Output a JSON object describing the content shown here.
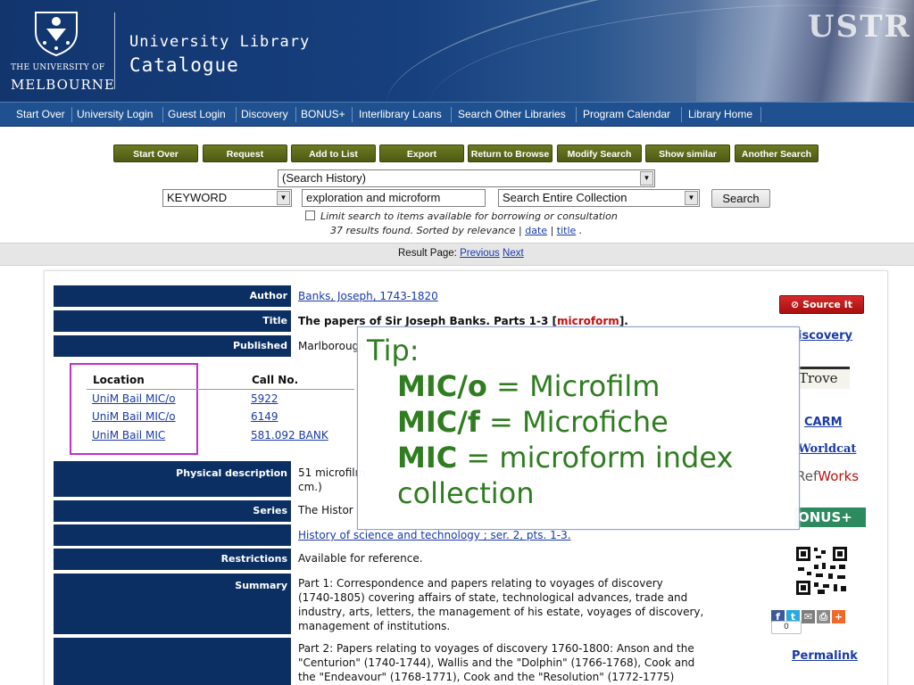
{
  "header": {
    "university_line1": "THE UNIVERSITY OF",
    "university_line2": "MELBOURNE",
    "title_line1": "University Library",
    "title_line2": "Catalogue",
    "banner_spine_text": "USTR"
  },
  "nav": {
    "items": [
      "Start Over",
      "University Login",
      "Guest Login",
      "Discovery",
      "BONUS+",
      "Interlibrary Loans",
      "Search Other Libraries",
      "Program Calendar",
      "Library Home"
    ]
  },
  "toolbar": {
    "buttons": [
      "Start Over",
      "Request",
      "Add to List",
      "Export",
      "Return to Browse",
      "Modify Search",
      "Show similar Items",
      "Another Search"
    ]
  },
  "search": {
    "history_select": "(Search History)",
    "index_select": "KEYWORD",
    "query": "exploration and microform",
    "scope_select": "Search Entire Collection",
    "search_button": "Search",
    "limit_label": "Limit search to items available for borrowing or consultation",
    "results_text": "37 results found. Sorted by relevance |",
    "sort_date": "date",
    "sort_sep": "|",
    "sort_title": "title",
    "sort_end": "."
  },
  "result_page": {
    "label": "Result Page:",
    "previous": "Previous",
    "next": "Next"
  },
  "record": {
    "author_label": "Author",
    "author_value": "Banks, Joseph, 1743-1820",
    "title_label": "Title",
    "title_value": "The papers of Sir Joseph Banks. Parts 1-3 [",
    "title_micro": "microform",
    "title_end": "].",
    "published_label": "Published",
    "published_value": "Marlborough",
    "physical_label": "Physical description",
    "physical_value_1": "51 microfilm",
    "physical_value_2": "cm.)",
    "series_label": "Series",
    "series_value": "The Histor",
    "series_link": "History of science and technology ; ser. 2, pts. 1-3.",
    "restrictions_label": "Restrictions",
    "restrictions_value": "Available for reference.",
    "summary_label": "Summary",
    "summary_1": [
      "Part 1: Correspondence and papers relating to voyages of discovery",
      "(1740-1805) covering affairs of state, technological advances, trade and",
      "industry, arts, letters, the management of his estate, voyages of discovery,",
      "management of institutions."
    ],
    "summary_2": [
      "Part 2: Papers relating to voyages of discovery 1760-1800: Anson and the",
      "\"Centurion\" (1740-1744), Wallis and the \"Dolphin\" (1766-1768), Cook and",
      "the \"Endeavour\" (1768-1771), Cook and the \"Resolution\" (1772-1775)"
    ]
  },
  "holdings": {
    "headers": [
      "Location",
      "Call No."
    ],
    "rows": [
      {
        "location": "UniM Bail MIC/o",
        "call_no": "5922"
      },
      {
        "location": "UniM Bail MIC/o",
        "call_no": "6149"
      },
      {
        "location": "UniM Bail MIC",
        "call_no": "581.092 BANK"
      }
    ]
  },
  "sidebar": {
    "source_it": "Source It",
    "discovery": "iscovery",
    "trove": "Trove",
    "carm": "CARM",
    "worldcat": "Worldcat",
    "refworks_1": "Ref",
    "refworks_2": "Works",
    "bonus": "ONUS+",
    "share_count": "0",
    "permalink": "Permalink"
  },
  "tip": {
    "heading": "Tip:",
    "line1_code": "MIC/o",
    "line1_rest": " =  Microfilm",
    "line2_code": "MIC/f",
    "line2_rest": "  =  Microfiche",
    "line3_code": "MIC",
    "line3_rest": " =  microform index",
    "line4": "collection"
  },
  "colors": {
    "nav_bg": "#1f5190",
    "label_bg": "#0c2f63",
    "tip_text": "#2f7d20",
    "highlight_box": "#c030c8",
    "link": "#1a3aa8"
  }
}
